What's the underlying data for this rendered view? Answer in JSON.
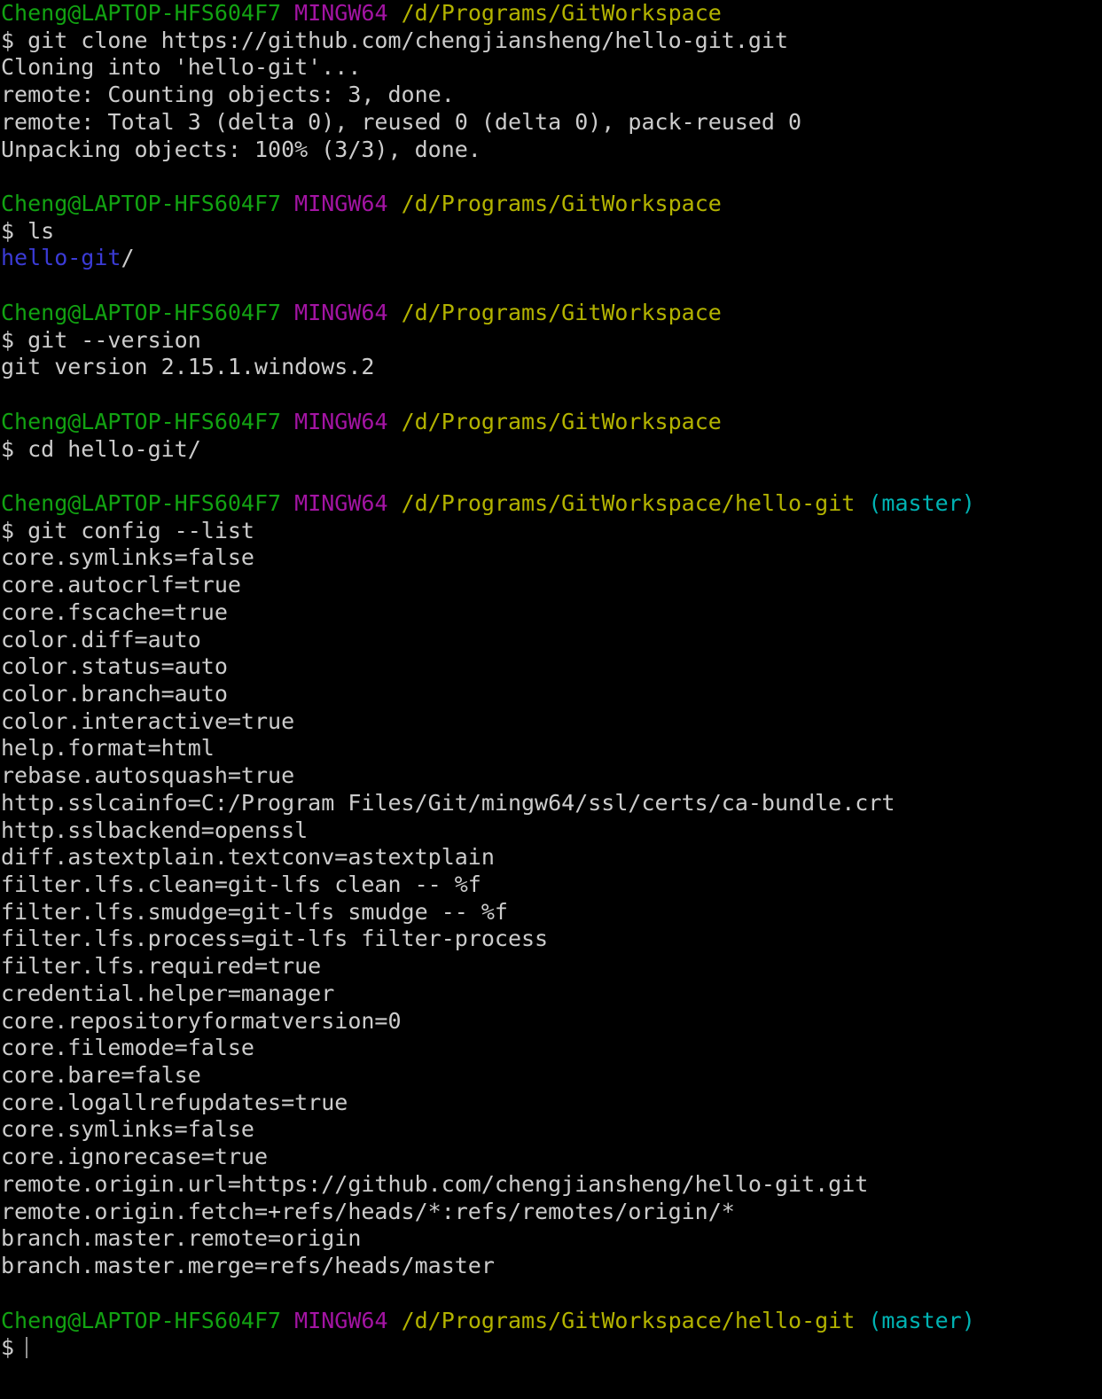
{
  "terminal": {
    "app": "MINGW64 Git Bash",
    "background_color": "#000000",
    "foreground_color": "#cccccc",
    "colors": {
      "user_host": "#12a312",
      "shell_tag": "#a314a3",
      "path": "#b3b300",
      "branch": "#00b3b3",
      "directory": "#3b3bd6",
      "text": "#cccccc",
      "cursor": "#8f8f8f"
    },
    "prompt": {
      "user_host": "Cheng@LAPTOP-HFS604F7",
      "shell_tag": "MINGW64",
      "path_workspace": "/d/Programs/GitWorkspace",
      "path_repo": "/d/Programs/GitWorkspace/hello-git",
      "branch": "(master)",
      "symbol": "$"
    },
    "lines": [
      {
        "type": "prompt",
        "path": "/d/Programs/GitWorkspace",
        "branch": ""
      },
      {
        "type": "command",
        "text": "$ git clone https://github.com/chengjiansheng/hello-git.git"
      },
      {
        "type": "output",
        "text": "Cloning into 'hello-git'..."
      },
      {
        "type": "output",
        "text": "remote: Counting objects: 3, done."
      },
      {
        "type": "output",
        "text": "remote: Total 3 (delta 0), reused 0 (delta 0), pack-reused 0"
      },
      {
        "type": "output",
        "text": "Unpacking objects: 100% (3/3), done."
      },
      {
        "type": "blank",
        "text": ""
      },
      {
        "type": "prompt",
        "path": "/d/Programs/GitWorkspace",
        "branch": ""
      },
      {
        "type": "command",
        "text": "$ ls"
      },
      {
        "type": "dirlist",
        "dir": "hello-git",
        "suffix": "/"
      },
      {
        "type": "blank",
        "text": ""
      },
      {
        "type": "prompt",
        "path": "/d/Programs/GitWorkspace",
        "branch": ""
      },
      {
        "type": "command",
        "text": "$ git --version"
      },
      {
        "type": "output",
        "text": "git version 2.15.1.windows.2"
      },
      {
        "type": "blank",
        "text": ""
      },
      {
        "type": "prompt",
        "path": "/d/Programs/GitWorkspace",
        "branch": ""
      },
      {
        "type": "command",
        "text": "$ cd hello-git/"
      },
      {
        "type": "blank",
        "text": ""
      },
      {
        "type": "prompt",
        "path": "/d/Programs/GitWorkspace/hello-git",
        "branch": "(master)"
      },
      {
        "type": "command",
        "text": "$ git config --list"
      },
      {
        "type": "output",
        "text": "core.symlinks=false"
      },
      {
        "type": "output",
        "text": "core.autocrlf=true"
      },
      {
        "type": "output",
        "text": "core.fscache=true"
      },
      {
        "type": "output",
        "text": "color.diff=auto"
      },
      {
        "type": "output",
        "text": "color.status=auto"
      },
      {
        "type": "output",
        "text": "color.branch=auto"
      },
      {
        "type": "output",
        "text": "color.interactive=true"
      },
      {
        "type": "output",
        "text": "help.format=html"
      },
      {
        "type": "output",
        "text": "rebase.autosquash=true"
      },
      {
        "type": "output",
        "text": "http.sslcainfo=C:/Program Files/Git/mingw64/ssl/certs/ca-bundle.crt"
      },
      {
        "type": "output",
        "text": "http.sslbackend=openssl"
      },
      {
        "type": "output",
        "text": "diff.astextplain.textconv=astextplain"
      },
      {
        "type": "output",
        "text": "filter.lfs.clean=git-lfs clean -- %f"
      },
      {
        "type": "output",
        "text": "filter.lfs.smudge=git-lfs smudge -- %f"
      },
      {
        "type": "output",
        "text": "filter.lfs.process=git-lfs filter-process"
      },
      {
        "type": "output",
        "text": "filter.lfs.required=true"
      },
      {
        "type": "output",
        "text": "credential.helper=manager"
      },
      {
        "type": "output",
        "text": "core.repositoryformatversion=0"
      },
      {
        "type": "output",
        "text": "core.filemode=false"
      },
      {
        "type": "output",
        "text": "core.bare=false"
      },
      {
        "type": "output",
        "text": "core.logallrefupdates=true"
      },
      {
        "type": "output",
        "text": "core.symlinks=false"
      },
      {
        "type": "output",
        "text": "core.ignorecase=true"
      },
      {
        "type": "output",
        "text": "remote.origin.url=https://github.com/chengjiansheng/hello-git.git"
      },
      {
        "type": "output",
        "text": "remote.origin.fetch=+refs/heads/*:refs/remotes/origin/*"
      },
      {
        "type": "output",
        "text": "branch.master.remote=origin"
      },
      {
        "type": "output",
        "text": "branch.master.merge=refs/heads/master"
      },
      {
        "type": "blank",
        "text": ""
      },
      {
        "type": "prompt",
        "path": "/d/Programs/GitWorkspace/hello-git",
        "branch": "(master)"
      },
      {
        "type": "input",
        "text": "$"
      }
    ]
  }
}
